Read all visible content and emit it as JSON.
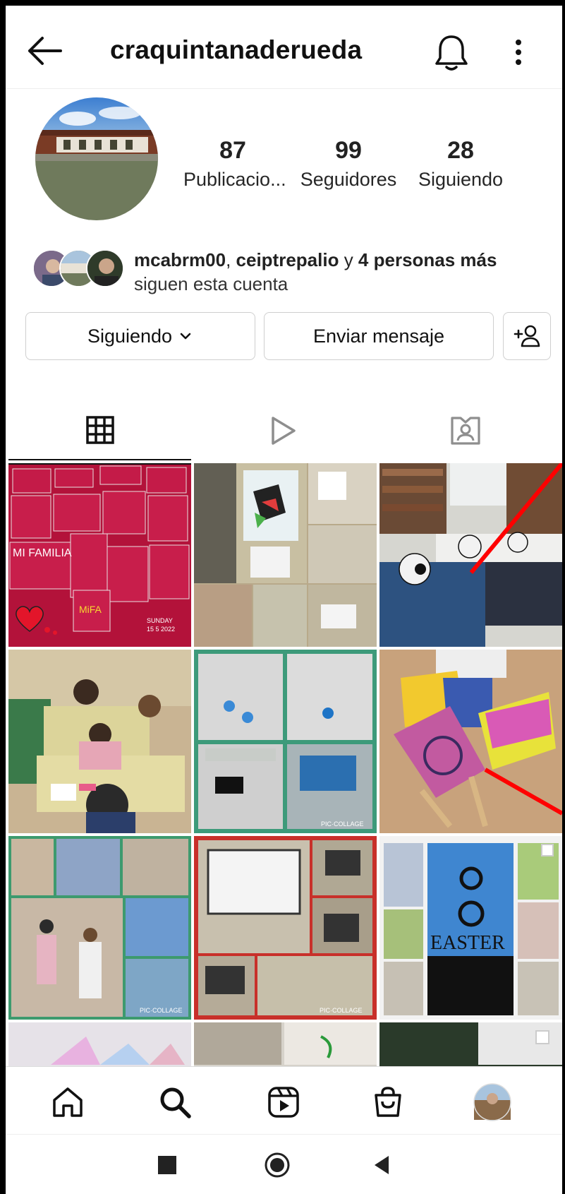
{
  "header": {
    "username": "craquintanaderueda",
    "back_icon": "arrow-left-icon",
    "bell_icon": "bell-icon",
    "more_icon": "more-vertical-icon"
  },
  "profile": {
    "stats": [
      {
        "value": "87",
        "label": "Publicacio..."
      },
      {
        "value": "99",
        "label": "Seguidores"
      },
      {
        "value": "28",
        "label": "Siguiendo"
      }
    ]
  },
  "followed_by": {
    "user1": "mcabrm00",
    "sep": ", ",
    "user2": "ceiptrepalio",
    "joiner": " y ",
    "more": "4 personas más",
    "line2": "siguen esta cuenta"
  },
  "actions": {
    "following_label": "Siguiendo",
    "message_label": "Enviar mensaje",
    "add_user_icon": "add-person-icon"
  },
  "tabs": [
    {
      "name": "grid",
      "icon": "grid-icon",
      "active": true
    },
    {
      "name": "reels",
      "icon": "reels-play-icon",
      "active": false
    },
    {
      "name": "tagged",
      "icon": "tagged-person-icon",
      "active": false
    }
  ],
  "grid": {
    "tiles": [
      {
        "caption": "MI FAMILIA",
        "sub": "SUNDAY 15 5 2022"
      },
      {
        "caption": ""
      },
      {
        "caption": ""
      },
      {
        "caption": ""
      },
      {
        "caption": "PIC·COLLAGE"
      },
      {
        "caption": ""
      },
      {
        "caption": "PIC·COLLAGE"
      },
      {
        "caption": "PIC·COLLAGE"
      },
      {
        "caption": "EASTER"
      }
    ]
  },
  "bottom_nav": [
    "home-icon",
    "search-icon",
    "reels-icon",
    "shop-icon",
    "profile-avatar"
  ],
  "system_nav": [
    "recents-button",
    "home-button",
    "back-button"
  ],
  "colors": {
    "text": "#262626",
    "border": "#cfcfcf",
    "annotation_red": "#ff0000"
  }
}
